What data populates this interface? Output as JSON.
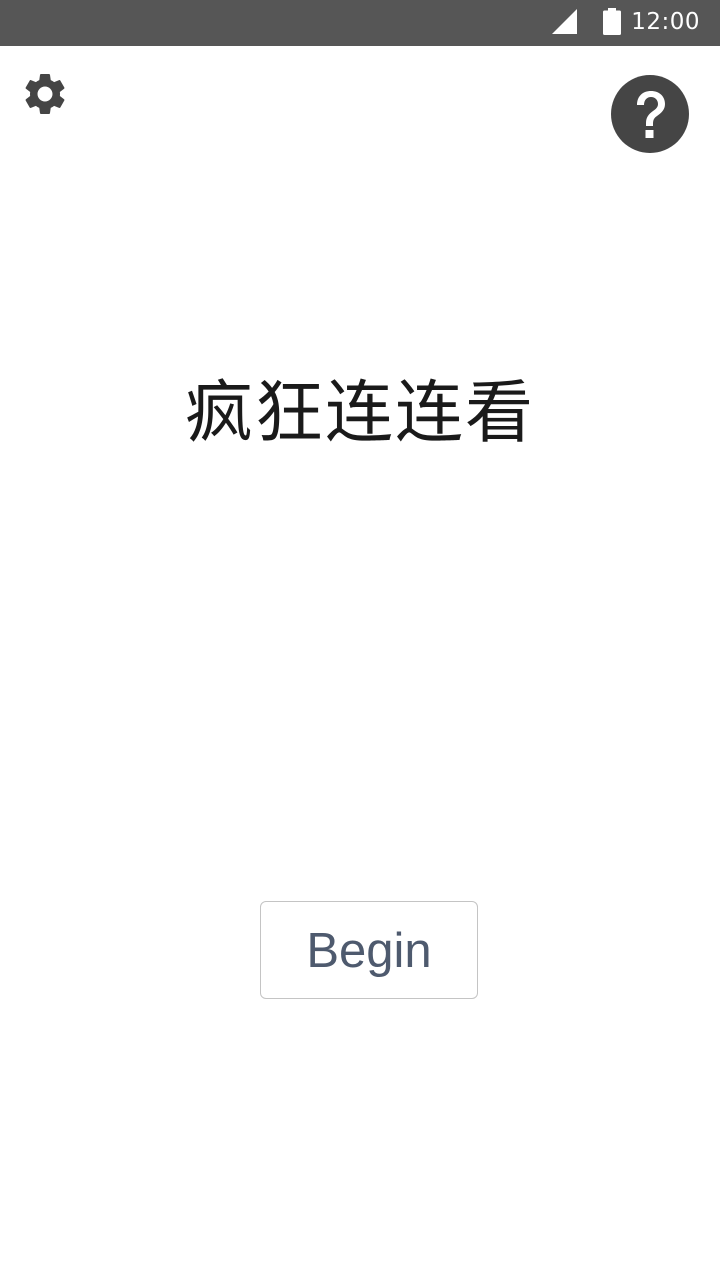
{
  "status_bar": {
    "time": "12:00",
    "signal_icon": "cellular-signal-icon",
    "battery_icon": "battery-full-icon",
    "background_color": "#565656"
  },
  "toolbar": {
    "settings_icon": "gear-icon",
    "help_icon": "question-circle-icon",
    "icon_color": "#454545"
  },
  "main": {
    "title": "疯狂连连看",
    "begin_label": "Begin"
  },
  "colors": {
    "title_text": "#1a1a1a",
    "begin_text": "#4e5a6e",
    "button_border": "#c4c4c4"
  }
}
